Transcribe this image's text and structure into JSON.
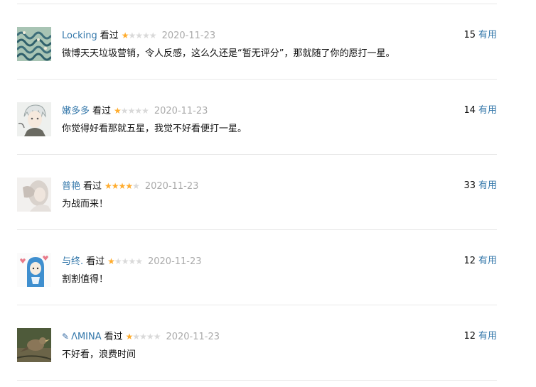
{
  "colors": {
    "link": "#3377aa",
    "star_filled": "#ffac2d",
    "star_empty": "#d9d9d9",
    "date": "#aaaaaa",
    "divider": "#e8e8e8"
  },
  "comments": [
    {
      "username": "Locking",
      "status": "看过",
      "rating": 1,
      "date": "2020-11-23",
      "text": "微博天天垃圾营销，令人反感，这么久还是“暂无评分”，那就随了你的愿打一星。",
      "votes": "15",
      "vote_label": "有用",
      "avatar_icon": "wave-painting-avatar"
    },
    {
      "username": "嫩多多",
      "status": "看过",
      "rating": 1,
      "date": "2020-11-23",
      "text": "你觉得好看那就五星，我觉不好看便打一星。",
      "votes": "14",
      "vote_label": "有用",
      "avatar_icon": "anime-boy-avatar"
    },
    {
      "username": "普艳",
      "status": "看过",
      "rating": 4,
      "date": "2020-11-23",
      "text": "为战而来！",
      "votes": "33",
      "vote_label": "有用",
      "avatar_icon": "portrait-avatar"
    },
    {
      "username": "与终.",
      "status": "看过",
      "rating": 1,
      "date": "2020-11-23",
      "text": "割割值得！",
      "votes": "12",
      "vote_label": "有用",
      "avatar_icon": "blue-hood-avatar"
    },
    {
      "username": "ΛMINA",
      "status": "看过",
      "rating": 1,
      "date": "2020-11-23",
      "text": "不好看，浪费时间",
      "votes": "12",
      "vote_label": "有用",
      "avatar_icon": "bird-photo-avatar",
      "has_pen_icon": true
    }
  ]
}
